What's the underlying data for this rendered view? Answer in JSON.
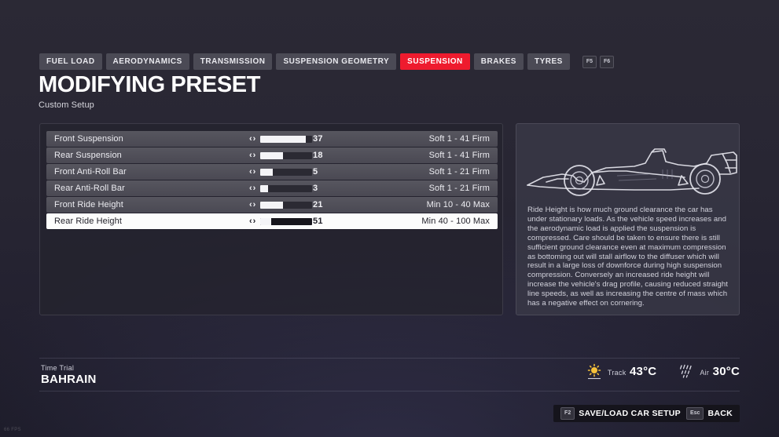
{
  "tabs": [
    {
      "label": "FUEL LOAD",
      "active": false
    },
    {
      "label": "AERODYNAMICS",
      "active": false
    },
    {
      "label": "TRANSMISSION",
      "active": false
    },
    {
      "label": "SUSPENSION GEOMETRY",
      "active": false
    },
    {
      "label": "SUSPENSION",
      "active": true
    },
    {
      "label": "BRAKES",
      "active": false
    },
    {
      "label": "TYRES",
      "active": false
    }
  ],
  "key_hints": [
    "F5",
    "F6"
  ],
  "heading": {
    "title": "MODIFYING PRESET",
    "subtitle": "Custom Setup"
  },
  "settings": [
    {
      "name": "Front Suspension",
      "value": "37",
      "range": "Soft 1 - 41 Firm",
      "fill_pct": 88,
      "selected": false
    },
    {
      "name": "Rear Suspension",
      "value": "18",
      "range": "Soft 1 - 41 Firm",
      "fill_pct": 43,
      "selected": false
    },
    {
      "name": "Front Anti-Roll Bar",
      "value": "5",
      "range": "Soft 1 - 21 Firm",
      "fill_pct": 24,
      "selected": false
    },
    {
      "name": "Rear Anti-Roll Bar",
      "value": "3",
      "range": "Soft 1 - 21 Firm",
      "fill_pct": 14,
      "selected": false
    },
    {
      "name": "Front Ride Height",
      "value": "21",
      "range": "Min 10 - 40 Max",
      "fill_pct": 43,
      "selected": false
    },
    {
      "name": "Rear Ride Height",
      "value": "51",
      "range": "Min 40 - 100 Max",
      "fill_pct": 21,
      "selected": true
    }
  ],
  "arrows": {
    "left": "‹",
    "right": "›"
  },
  "info": {
    "car_icon": "f1-car-side-icon",
    "description": "Ride Height is how much ground clearance the car has under stationary loads. As the vehicle speed increases and the aerodynamic load is applied the suspension is compressed. Care should be taken to ensure there is still sufficient ground clearance even at maximum compression as bottoming out will stall airflow to the diffuser which will result in a large loss of downforce during high suspension compression. Conversely an increased ride height will increase the vehicle's drag profile, causing reduced straight line speeds, as well as increasing the centre of mass which has a negative effect on cornering."
  },
  "status": {
    "mode": "Time Trial",
    "track": "BAHRAIN"
  },
  "weather": [
    {
      "icon": "sun-icon",
      "label": "Track",
      "value": "43°C"
    },
    {
      "icon": "rain-icon",
      "label": "Air",
      "value": "30°C"
    }
  ],
  "actions": [
    {
      "key": "F2",
      "label": "SAVE/LOAD CAR SETUP"
    },
    {
      "key": "Esc",
      "label": "BACK"
    }
  ],
  "fps": "66 FPS",
  "colors": {
    "accent_red": "#ee1b2e",
    "tab_bg": "#4b4a55",
    "row_bg": "#4f4e58",
    "selected_row_bg": "#fcfcfc",
    "sun_yellow": "#f5c13a"
  }
}
